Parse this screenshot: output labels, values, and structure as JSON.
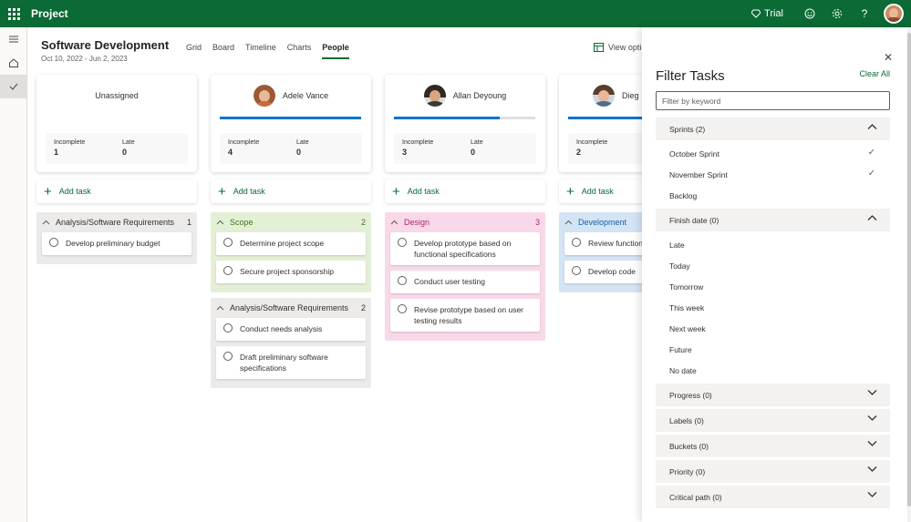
{
  "topbar": {
    "app_name": "Project",
    "trial_label": "Trial"
  },
  "project": {
    "title": "Software Development",
    "dates": "Oct 10, 2022 - Jun 2, 2023"
  },
  "views": {
    "grid": "Grid",
    "board": "Board",
    "timeline": "Timeline",
    "charts": "Charts",
    "people": "People",
    "view_options": "View opti"
  },
  "columns": [
    {
      "name": "Unassigned",
      "incomplete_label": "Incomplete",
      "incomplete": "1",
      "late_label": "Late",
      "late": "0",
      "add_task": "Add task",
      "bucket1": {
        "name": "Analysis/Software Requirements",
        "count": "1",
        "tasks": [
          "Develop preliminary budget"
        ]
      }
    },
    {
      "name": "Adele Vance",
      "progress": 1.0,
      "incomplete_label": "Incomplete",
      "incomplete": "4",
      "late_label": "Late",
      "late": "0",
      "add_task": "Add task",
      "bucket1": {
        "name": "Scope",
        "count": "2",
        "tasks": [
          "Determine project scope",
          "Secure project sponsorship"
        ]
      },
      "bucket2": {
        "name": "Analysis/Software Requirements",
        "count": "2",
        "tasks": [
          "Conduct needs analysis",
          "Draft preliminary software specifications"
        ]
      }
    },
    {
      "name": "Allan Deyoung",
      "progress": 0.75,
      "incomplete_label": "Incomplete",
      "incomplete": "3",
      "late_label": "Late",
      "late": "0",
      "add_task": "Add task",
      "bucket1": {
        "name": "Design",
        "count": "3",
        "tasks": [
          "Develop prototype based on functional specifications",
          "Conduct user testing",
          "Revise prototype based on user testing results"
        ]
      }
    },
    {
      "name": "Dieg",
      "progress": 1.0,
      "incomplete_label": "Incomplete",
      "incomplete": "2",
      "add_task": "Add task",
      "bucket1": {
        "name": "Development",
        "tasks": [
          "Review function",
          "Develop code"
        ]
      }
    }
  ],
  "filter_panel": {
    "title": "Filter Tasks",
    "clear_all": "Clear All",
    "keyword_placeholder": "Filter by keyword",
    "sprints": {
      "label": "Sprints (2)",
      "options": [
        "October Sprint",
        "November Sprint",
        "Backlog"
      ]
    },
    "finish_date": {
      "label": "Finish date (0)",
      "options": [
        "Late",
        "Today",
        "Tomorrow",
        "This week",
        "Next week",
        "Future",
        "No date"
      ]
    },
    "collapsed": [
      "Progress (0)",
      "Labels (0)",
      "Buckets (0)",
      "Priority (0)",
      "Critical path (0)"
    ]
  },
  "colors": {
    "brand": "#0b6a35",
    "progress": "#0f72d1",
    "scope_bucket": "#e3f0d5",
    "analysis_bucket": "#edebe9",
    "design_bucket": "#f9d9e9",
    "development_bucket": "#d3e4f5"
  }
}
